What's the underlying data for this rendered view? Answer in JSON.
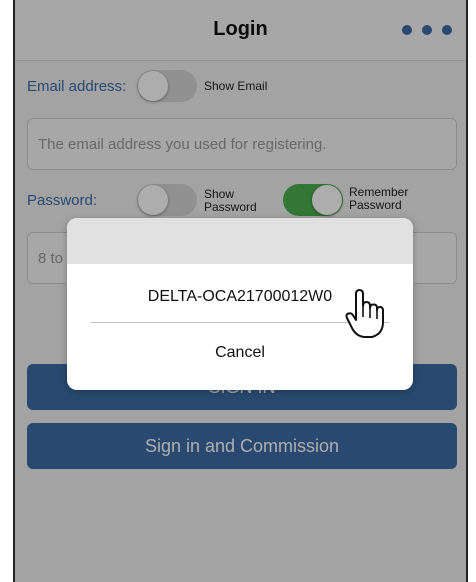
{
  "header": {
    "title": "Login",
    "menu_icon": "more-dots-icon"
  },
  "form": {
    "email_label": "Email address:",
    "show_email_label": "Show Email",
    "email_placeholder": "The email address you used for registering.",
    "password_label": "Password:",
    "show_password_label_1": "Show",
    "show_password_label_2": "Password",
    "remember_label_1": "Remember",
    "remember_label_2": "Password",
    "password_placeholder": "8 to",
    "show_email_on": false,
    "show_password_on": false,
    "remember_on": true
  },
  "buttons": {
    "sign_in": "SIGN IN",
    "sign_in_commission": "Sign in and Commission"
  },
  "dialog": {
    "device": "DELTA-OCA21700012W0",
    "cancel": "Cancel"
  },
  "colors": {
    "accent": "#3d6ca6",
    "toggle_on": "#4caf50"
  },
  "cursor_icon": "hand-pointer-icon"
}
